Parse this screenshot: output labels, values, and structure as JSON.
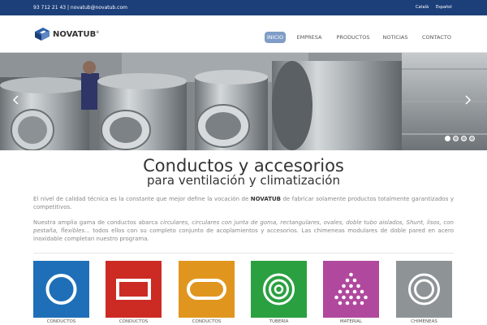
{
  "topbar": {
    "contact": "93 712 21 43 | novatub@novatub.com",
    "languages": [
      "Català",
      "Español"
    ]
  },
  "brand": {
    "name": "NOVATUB",
    "registered": "®"
  },
  "nav": [
    "INICIO",
    "EMPRESA",
    "PRODUCTOS",
    "NOTICIAS",
    "CONTACTO"
  ],
  "hero": {
    "slides": 4,
    "active_slide": 1,
    "prev_icon": "chevron-left-icon",
    "next_icon": "chevron-right-icon"
  },
  "intro": {
    "title": "Conductos y accesorios",
    "subtitle": "para ventilación y climatización",
    "p1_before": "El nivel de calidad técnica es la constante que mejor define la vocación de ",
    "p1_brand": "NOVATUB",
    "p1_after": " de fabricar solamente productos totalmente garantizados y competitivos.",
    "p2_before": "Nuestra amplia gama de conductos abarca ",
    "p2_italic": "circulares, circulares con junta de goma, rectangulares, ovales, doble tubo aislados, Shunt, lisos, con pestaña, flexibles...",
    "p2_after": " todos ellos con su completo conjunto de acoplamientos y accesorios. Las chimeneas modulares de doble pared en acero inoxidable completan nuestro programa."
  },
  "colors": {
    "topbar": "#1c3f7a",
    "nav_active": "#7f9dc7",
    "tiles": [
      "#1f6fb8",
      "#cc2b24",
      "#e0961e",
      "#2aa040",
      "#b0499d",
      "#8e9396"
    ]
  },
  "categories": [
    {
      "label": "CONDUCTOS",
      "icon": "circle-icon"
    },
    {
      "label": "CONDUCTOS",
      "icon": "rectangle-icon"
    },
    {
      "label": "CONDUCTOS",
      "icon": "oval-icon"
    },
    {
      "label": "TUBERÍA",
      "icon": "concentric-circles-icon"
    },
    {
      "label": "MATERIAL",
      "icon": "dots-triangle-icon"
    },
    {
      "label": "CHIMENEAS",
      "icon": "double-circle-icon"
    }
  ]
}
